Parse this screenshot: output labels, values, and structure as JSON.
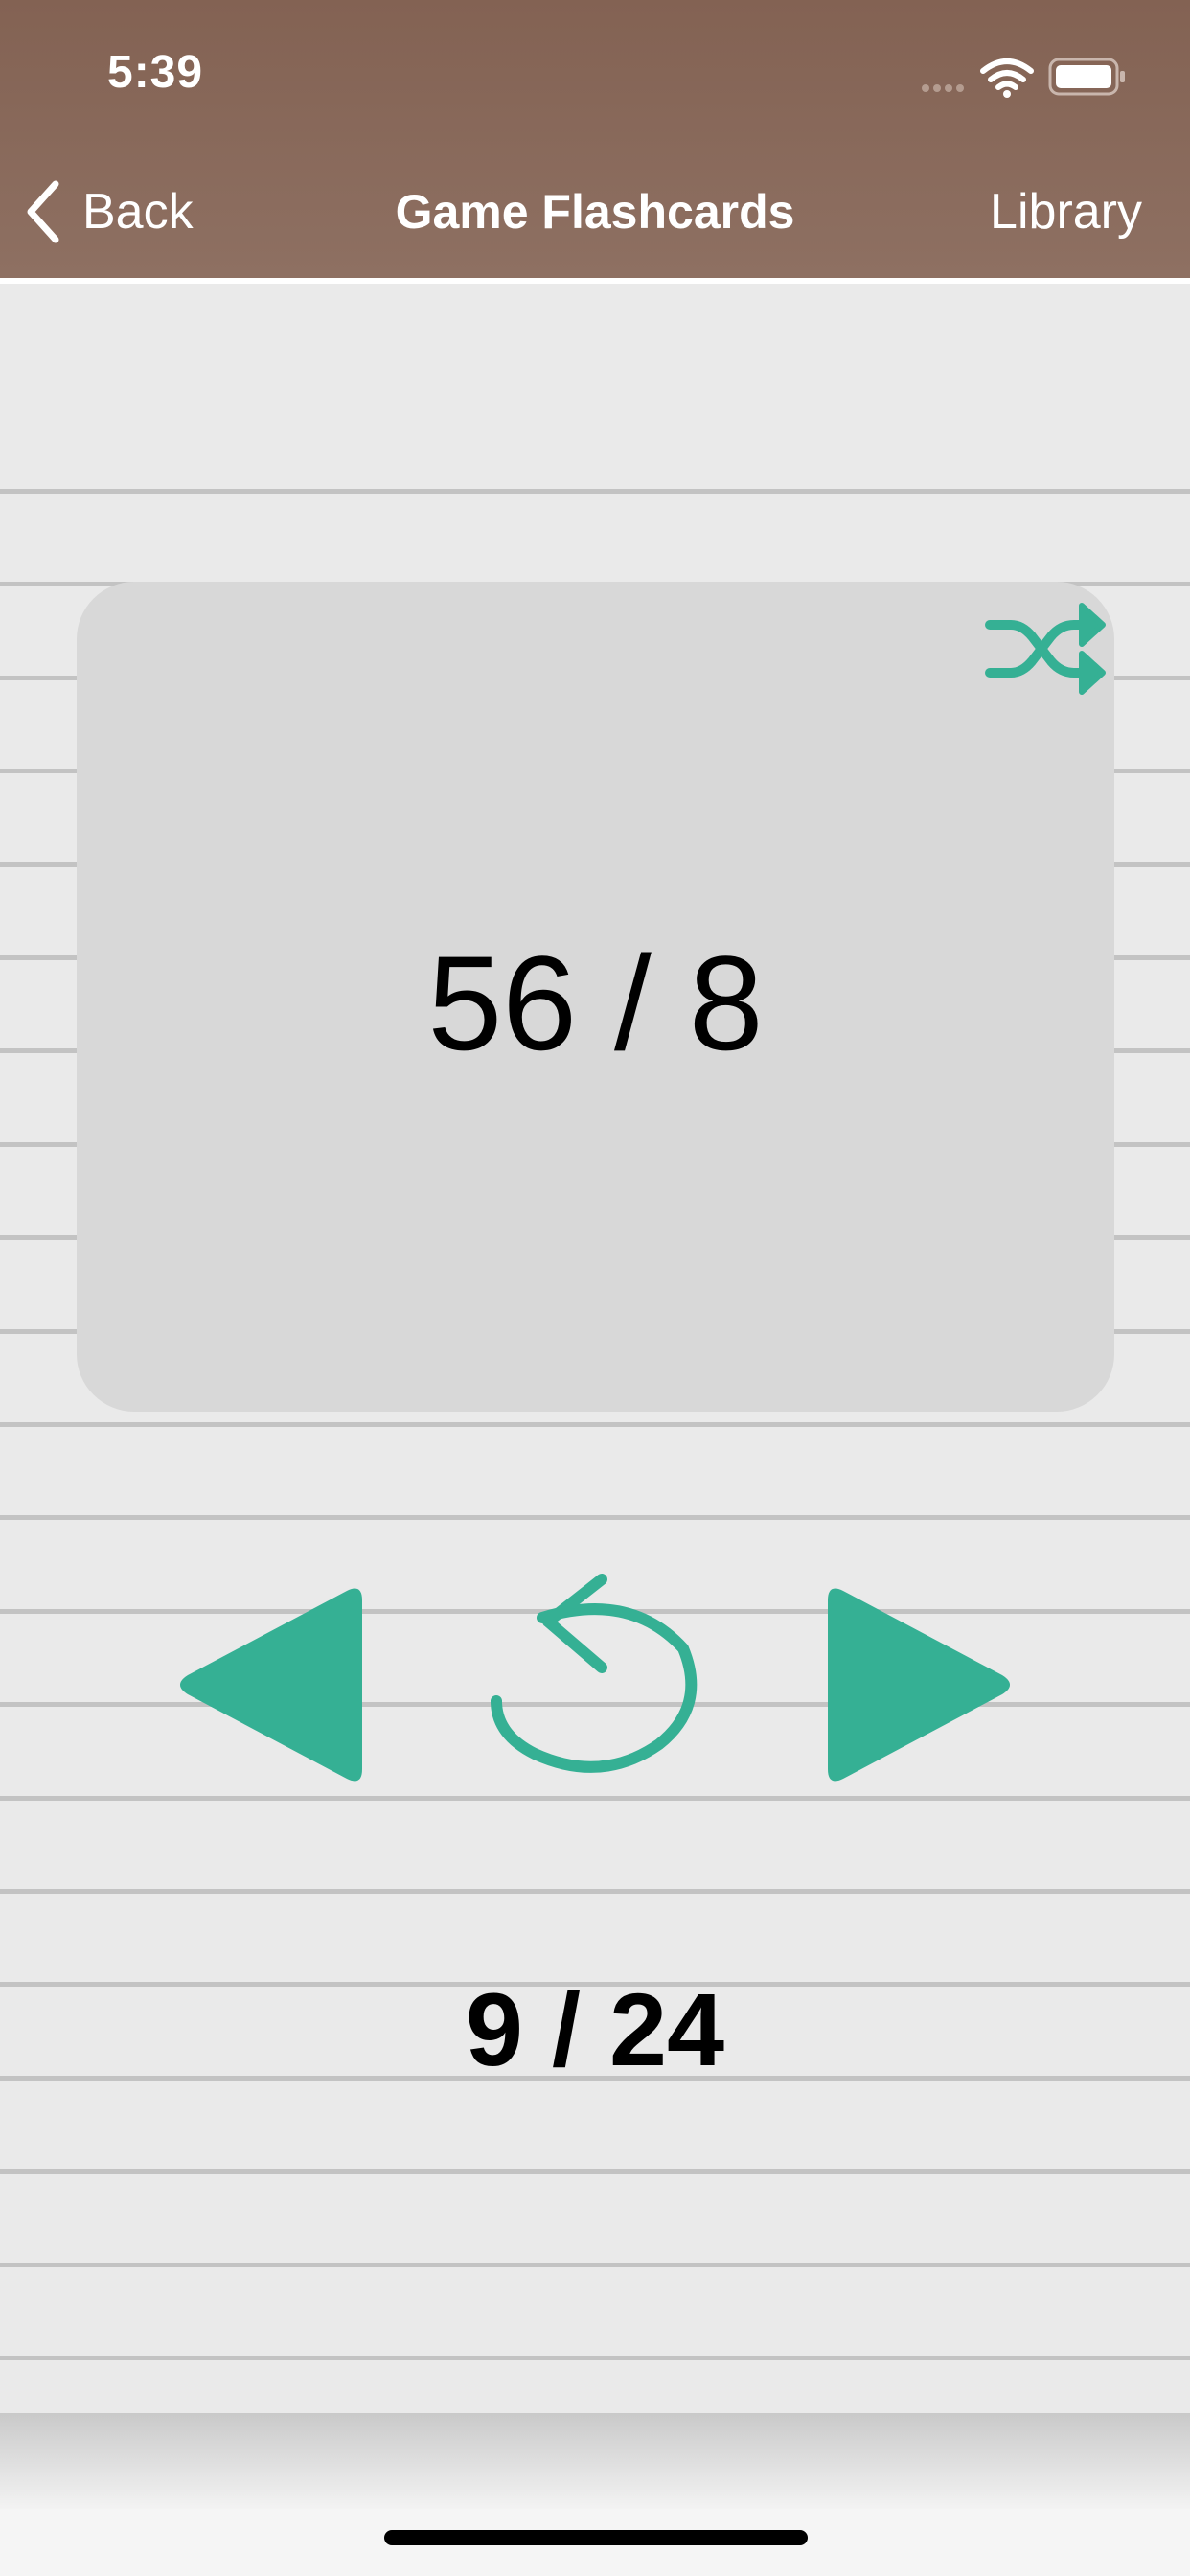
{
  "status_bar": {
    "time": "5:39"
  },
  "nav": {
    "back_label": "Back",
    "title": "Game Flashcards",
    "right_label": "Library"
  },
  "card": {
    "text": "56 / 8"
  },
  "counter": {
    "text": "9 / 24"
  },
  "colors": {
    "header": "#836253",
    "accent": "#35b094",
    "paper": "#eaeaea",
    "card": "#d8d8d8"
  },
  "icons": {
    "back": "chevron-left-icon",
    "shuffle": "shuffle-icon",
    "previous": "triangle-left-icon",
    "flip": "undo-icon",
    "next": "triangle-right-icon"
  }
}
